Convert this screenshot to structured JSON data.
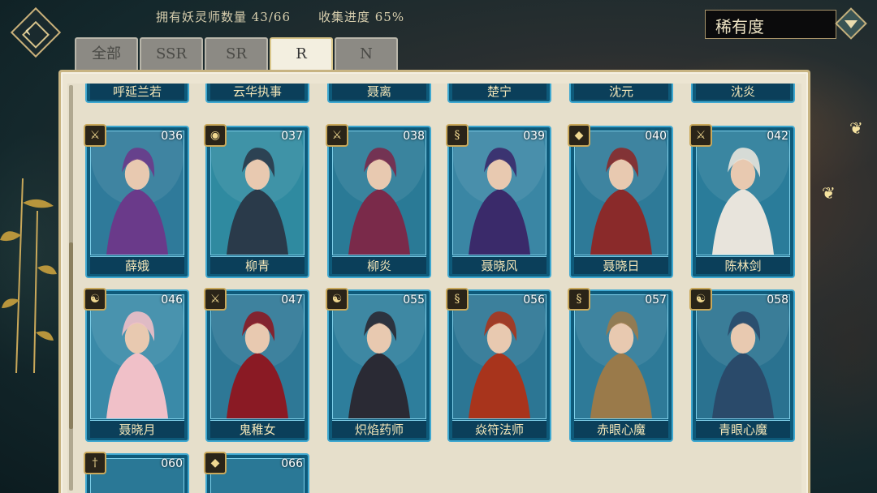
{
  "header": {
    "owned_label": "拥有妖灵师数量 43/66",
    "progress_label": "收集进度 65%"
  },
  "sort": {
    "selected": "稀有度"
  },
  "tabs": [
    {
      "label": "全部",
      "active": false
    },
    {
      "label": "SSR",
      "active": false
    },
    {
      "label": "SR",
      "active": false
    },
    {
      "label": "R",
      "active": true
    },
    {
      "label": "N",
      "active": false
    }
  ],
  "top_row": [
    {
      "name": "呼延兰若"
    },
    {
      "name": "云华执事"
    },
    {
      "name": "聂离"
    },
    {
      "name": "楚宁"
    },
    {
      "name": "沈元"
    },
    {
      "name": "沈炎"
    }
  ],
  "row1": [
    {
      "num": "036",
      "name": "薛娥",
      "role_icon": "blade-icon",
      "glyph": "⚔",
      "bg": "#2f7a9a",
      "fig": "#6a3a8a"
    },
    {
      "num": "037",
      "name": "柳青",
      "role_icon": "eye-icon",
      "glyph": "◉",
      "bg": "#2f8aa0",
      "fig": "#2a3a4a"
    },
    {
      "num": "038",
      "name": "柳炎",
      "role_icon": "blade-icon",
      "glyph": "⚔",
      "bg": "#2a7a96",
      "fig": "#7a2a4a"
    },
    {
      "num": "039",
      "name": "聂晓风",
      "role_icon": "scroll-icon",
      "glyph": "§",
      "bg": "#3a86a4",
      "fig": "#3a2a6a"
    },
    {
      "num": "040",
      "name": "聂晓日",
      "role_icon": "shield-icon",
      "glyph": "◆",
      "bg": "#2e7a98",
      "fig": "#8a2a2a"
    },
    {
      "num": "042",
      "name": "陈林剑",
      "role_icon": "blade-icon",
      "glyph": "⚔",
      "bg": "#2a7c9a",
      "fig": "#e8e4dc"
    }
  ],
  "row2": [
    {
      "num": "046",
      "name": "聂晓月",
      "role_icon": "taiji-icon",
      "glyph": "☯",
      "bg": "#3a8aa8",
      "fig": "#f0c0c8"
    },
    {
      "num": "047",
      "name": "鬼稚女",
      "role_icon": "blade-icon",
      "glyph": "⚔",
      "bg": "#2e7896",
      "fig": "#8a1a24"
    },
    {
      "num": "055",
      "name": "炽焰药师",
      "role_icon": "taiji-icon",
      "glyph": "☯",
      "bg": "#2e7e9c",
      "fig": "#2a2a34"
    },
    {
      "num": "056",
      "name": "焱符法师",
      "role_icon": "scroll-icon",
      "glyph": "§",
      "bg": "#2c7694",
      "fig": "#a8341c"
    },
    {
      "num": "057",
      "name": "赤眼心魔",
      "role_icon": "scroll-icon",
      "glyph": "§",
      "bg": "#2e7a98",
      "fig": "#9a7a4a"
    },
    {
      "num": "058",
      "name": "青眼心魔",
      "role_icon": "taiji-icon",
      "glyph": "☯",
      "bg": "#2a7290",
      "fig": "#2a4a6a"
    }
  ],
  "row3": [
    {
      "num": "060",
      "role_icon": "sword-icon",
      "glyph": "†"
    },
    {
      "num": "066",
      "role_icon": "shield-icon",
      "glyph": "◆"
    }
  ]
}
